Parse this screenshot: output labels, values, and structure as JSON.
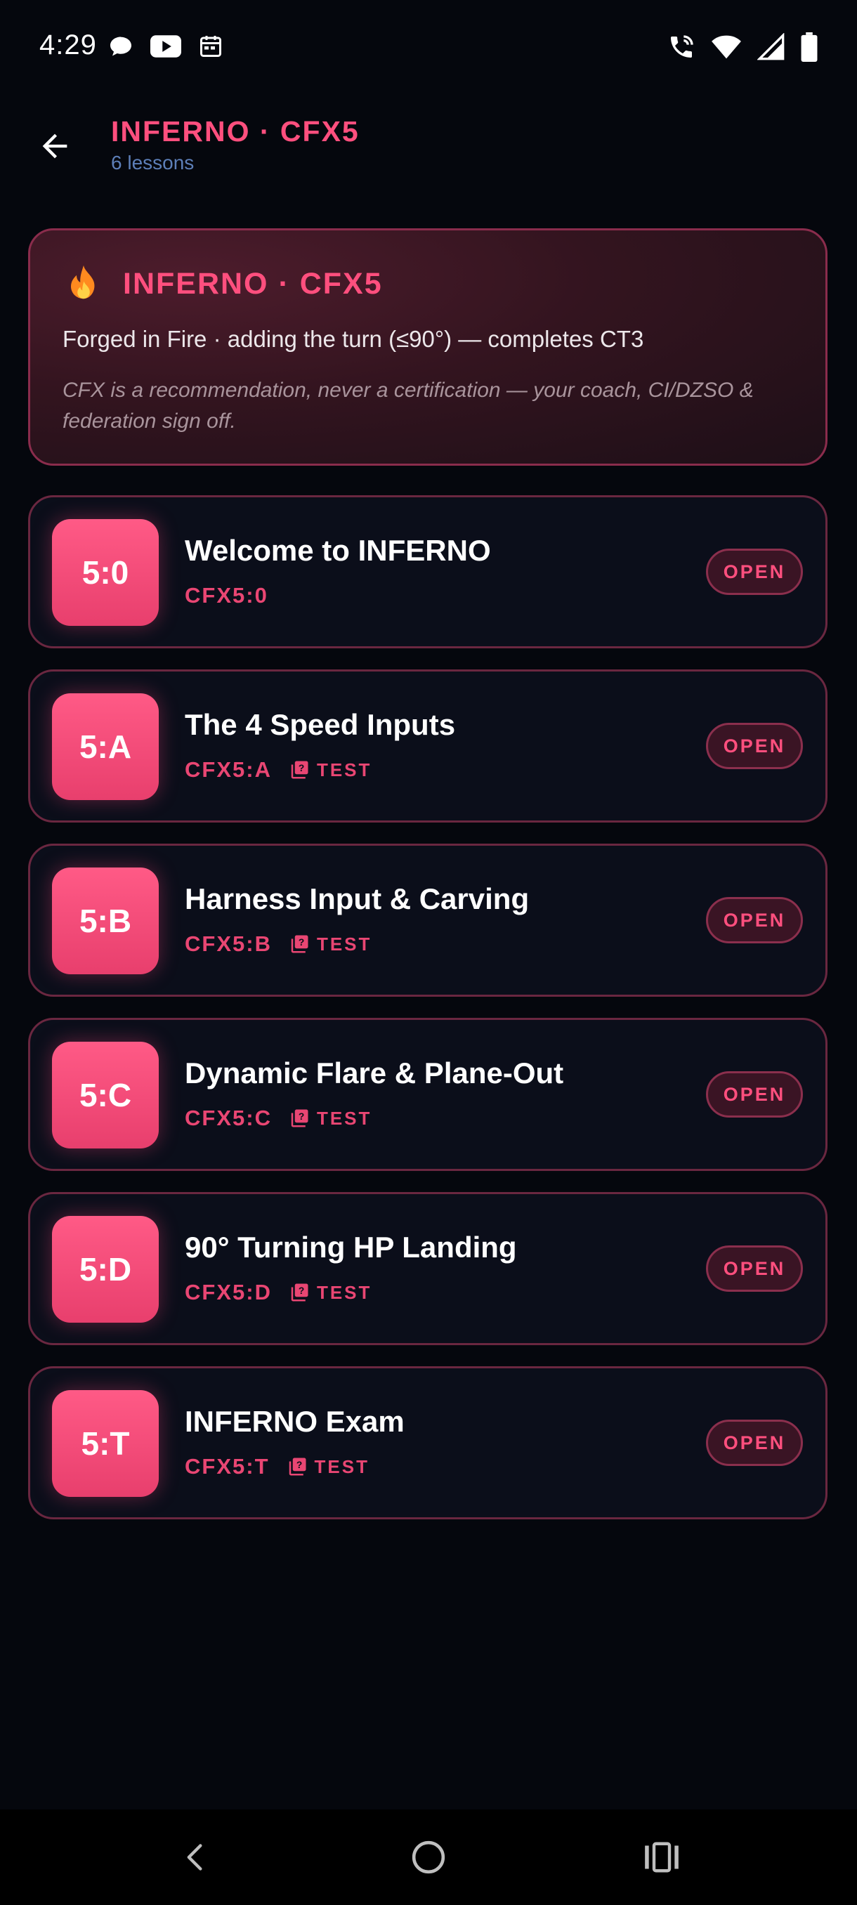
{
  "status_bar": {
    "time": "4:29"
  },
  "app_bar": {
    "title": "INFERNO · CFX5",
    "subtitle": "6 lessons"
  },
  "hero": {
    "icon": "fire-icon",
    "title": "INFERNO · CFX5",
    "description": "Forged in Fire · adding the turn (≤90°) — completes CT3",
    "note": "CFX is a recommendation, never a certification — your coach, CI/DZSO & federation sign off."
  },
  "lessons": [
    {
      "badge": "5:0",
      "title": "Welcome to INFERNO",
      "code": "CFX5:0",
      "test": "",
      "action": "OPEN"
    },
    {
      "badge": "5:A",
      "title": "The 4 Speed Inputs",
      "code": "CFX5:A",
      "test": "TEST",
      "action": "OPEN"
    },
    {
      "badge": "5:B",
      "title": "Harness Input & Carving",
      "code": "CFX5:B",
      "test": "TEST",
      "action": "OPEN"
    },
    {
      "badge": "5:C",
      "title": "Dynamic Flare & Plane-Out",
      "code": "CFX5:C",
      "test": "TEST",
      "action": "OPEN"
    },
    {
      "badge": "5:D",
      "title": "90° Turning HP Landing",
      "code": "CFX5:D",
      "test": "TEST",
      "action": "OPEN"
    },
    {
      "badge": "5:T",
      "title": "INFERNO Exam",
      "code": "CFX5:T",
      "test": "TEST",
      "action": "OPEN"
    }
  ],
  "colors": {
    "accent": "#ff4f7e",
    "background": "#05070d",
    "card": "#0b0e1a",
    "subtitle": "#5d7fb8"
  }
}
